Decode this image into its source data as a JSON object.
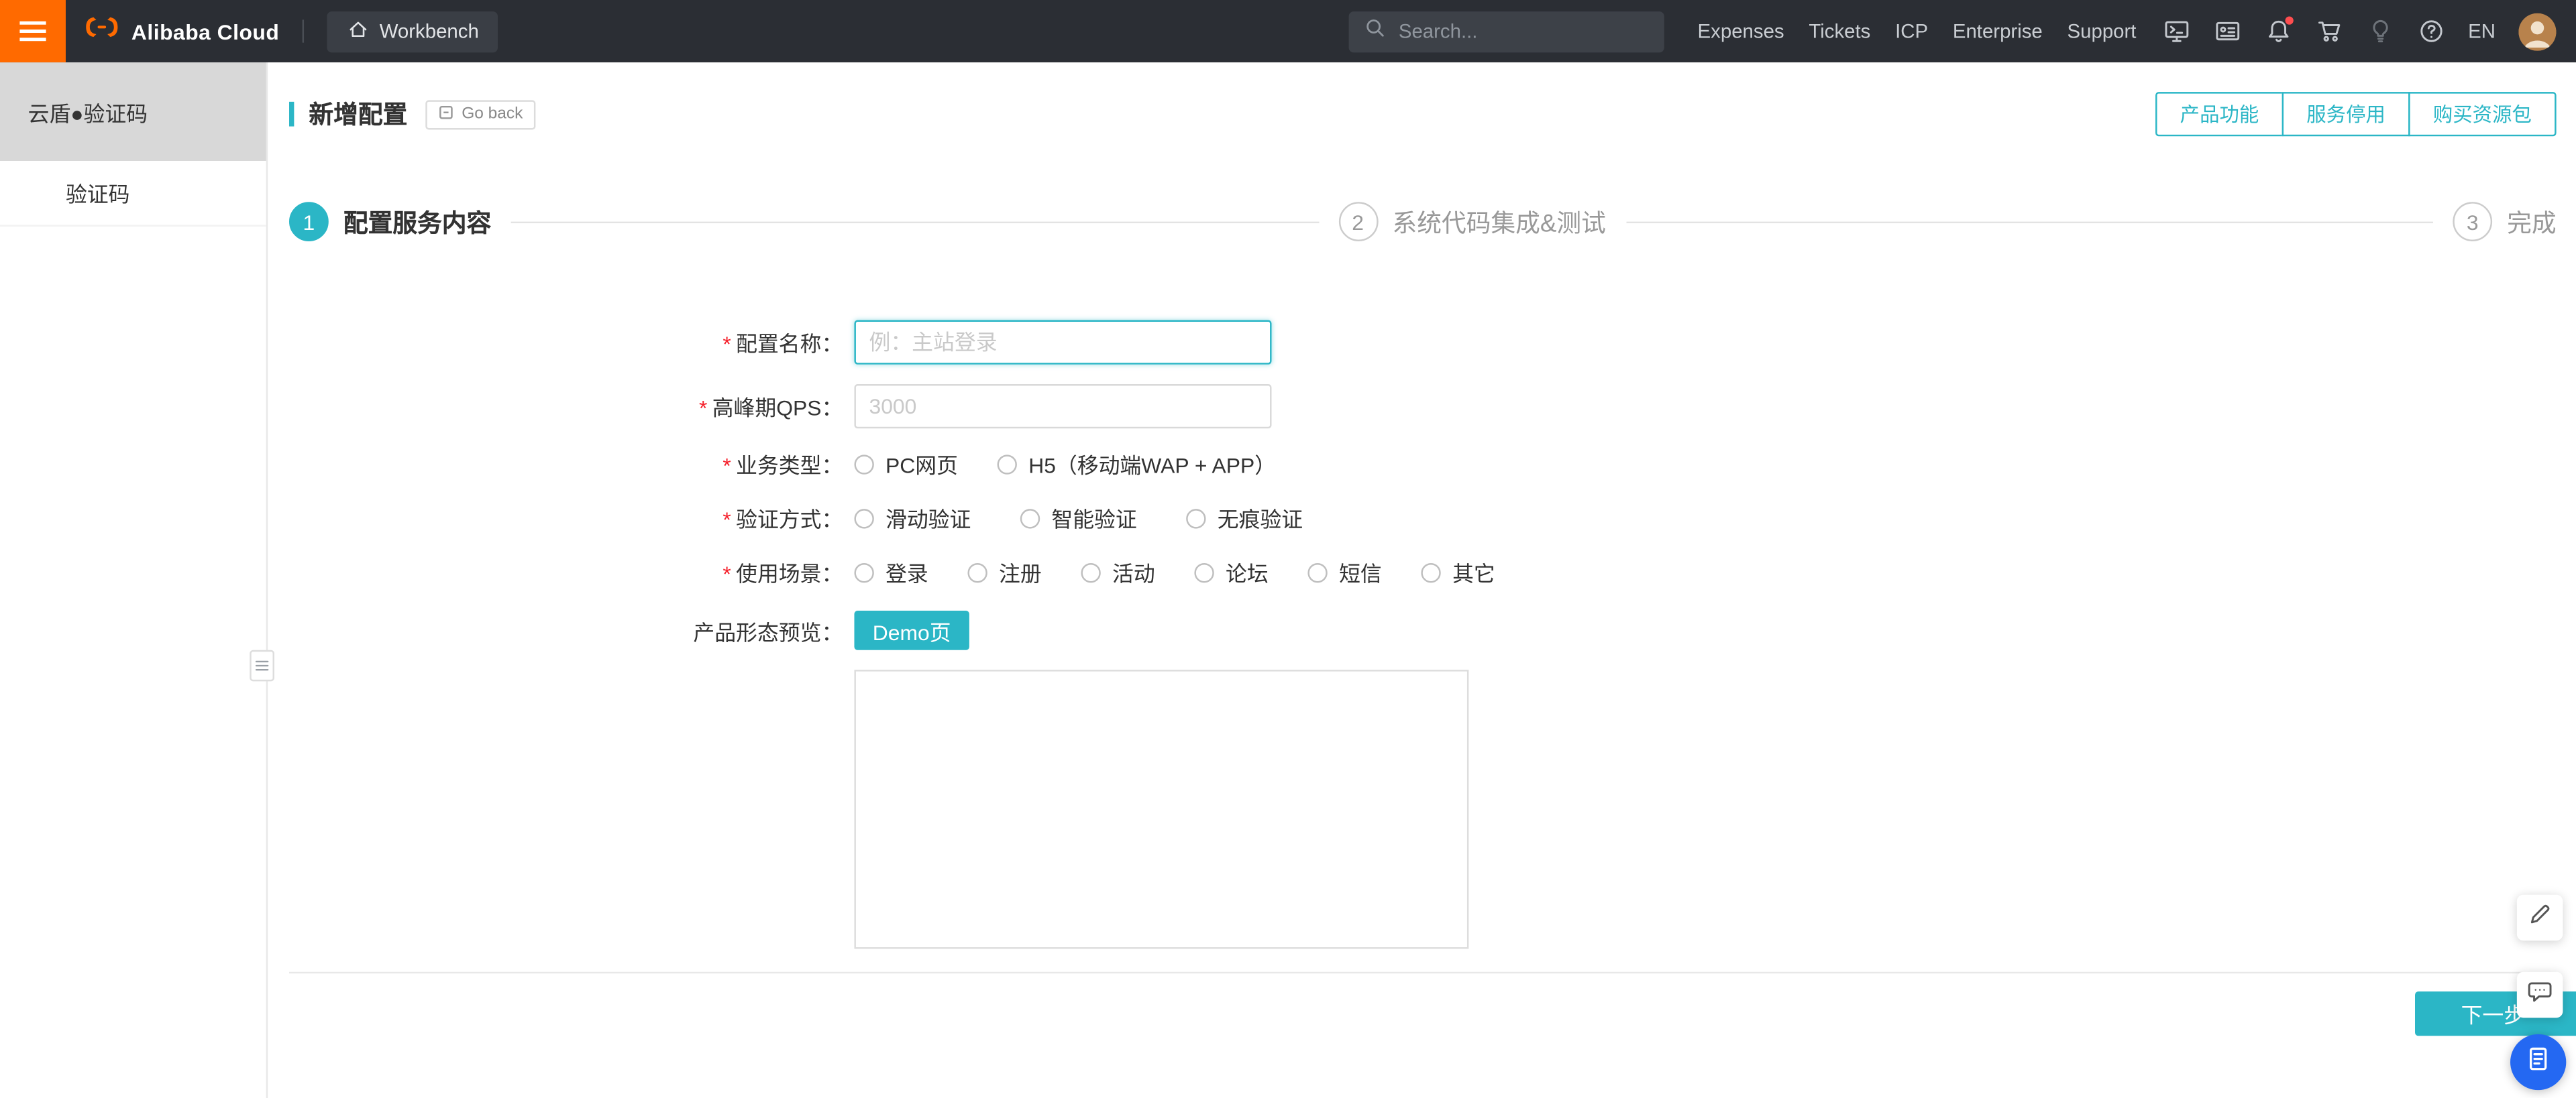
{
  "colors": {
    "accent": "#2bb6c6",
    "brand_orange": "#ff6a00",
    "topbar_bg": "#2b2e34",
    "required_red": "#f5222d",
    "fab_blue": "#2468f2"
  },
  "topbar": {
    "brand": "Alibaba Cloud",
    "workbench_label": "Workbench",
    "search_placeholder": "Search...",
    "nav_links": [
      "Expenses",
      "Tickets",
      "ICP",
      "Enterprise",
      "Support"
    ],
    "language": "EN",
    "icons": [
      "terminal-icon",
      "app-icon",
      "bell-icon",
      "cart-icon",
      "lightbulb-icon",
      "help-icon"
    ],
    "bell_has_unread": true
  },
  "sidebar": {
    "product_title": "云盾●验证码",
    "menu_items": [
      "验证码"
    ]
  },
  "content": {
    "page_title": "新增配置",
    "go_back_label": "Go back",
    "header_buttons": [
      "产品功能",
      "服务停用",
      "购买资源包"
    ],
    "steps": [
      {
        "number": "1",
        "label": "配置服务内容",
        "state": "active"
      },
      {
        "number": "2",
        "label": "系统代码集成&测试",
        "state": "pending"
      },
      {
        "number": "3",
        "label": "完成",
        "state": "pending"
      }
    ],
    "form": {
      "required_marker": "*",
      "config_name": {
        "label": "配置名称：",
        "placeholder": "例：主站登录",
        "value": ""
      },
      "peak_qps": {
        "label": "高峰期QPS：",
        "placeholder": "3000",
        "value": ""
      },
      "business_type": {
        "label": "业务类型：",
        "options": [
          "PC网页",
          "H5（移动端WAP + APP）"
        ]
      },
      "verify_method": {
        "label": "验证方式：",
        "options": [
          "滑动验证",
          "智能验证",
          "无痕验证"
        ]
      },
      "use_scene": {
        "label": "使用场景：",
        "options": [
          "登录",
          "注册",
          "活动",
          "论坛",
          "短信",
          "其它"
        ]
      },
      "preview": {
        "label": "产品形态预览：",
        "demo_button": "Demo页"
      }
    },
    "next_button": "下一步"
  }
}
